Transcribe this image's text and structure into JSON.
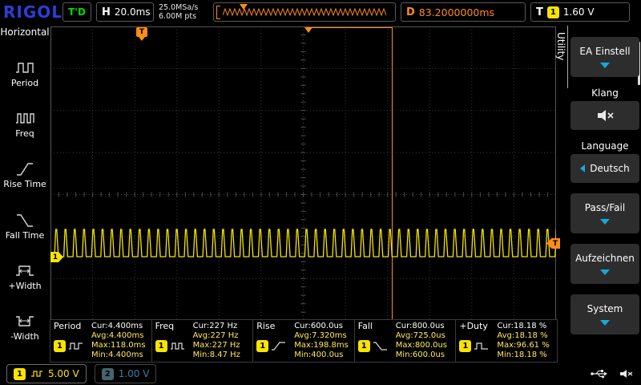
{
  "brand": "RIGOL",
  "topbar": {
    "trig_status": "T'D",
    "h_label": "H",
    "timebase": "20.0ms",
    "sample_rate": "25.0MSa/s",
    "memory_depth": "6.00M pts",
    "d_label": "D",
    "delay": "83.2000000ms",
    "t_label": "T",
    "trig_source": "1",
    "trig_level": "1.60 V"
  },
  "left_menu": {
    "title": "Horizontal",
    "items": [
      {
        "label": "Period"
      },
      {
        "label": "Freq"
      },
      {
        "label": "Rise Time"
      },
      {
        "label": "Fall Time"
      },
      {
        "label": "+Width"
      },
      {
        "label": "-Width"
      }
    ]
  },
  "right_menu": {
    "tab": "Utility",
    "io_setup": "EA Einstell",
    "sound": "Klang",
    "language_label": "Language",
    "language_value": "Deutsch",
    "pass_fail": "Pass/Fail",
    "record": "Aufzeichnen",
    "system": "System"
  },
  "measurements": [
    {
      "name": "Period",
      "source": "1",
      "cur": "Cur:4.400ms",
      "avg": "Avg:4.400ms",
      "max": "Max:118.0ms",
      "min": "Min:4.400ms"
    },
    {
      "name": "Freq",
      "source": "1",
      "cur": "Cur:227 Hz",
      "avg": "Avg:227 Hz",
      "max": "Max:227 Hz",
      "min": "Min:8.47 Hz"
    },
    {
      "name": "Rise",
      "source": "1",
      "cur": "Cur:600.0us",
      "avg": "Avg:7.320ms",
      "max": "Max:198.8ms",
      "min": "Min:400.0us"
    },
    {
      "name": "Fall",
      "source": "1",
      "cur": "Cur:800.0us",
      "avg": "Avg:725.0us",
      "max": "Max:800.0us",
      "min": "Min:600.0us"
    },
    {
      "name": "+Duty",
      "source": "1",
      "cur": "Cur:18.18 %",
      "avg": "Avg:18.18 %",
      "max": "Max:96.61 %",
      "min": "Min:18.18 %"
    }
  ],
  "channels": [
    {
      "num": "1",
      "scale": "5.00 V"
    },
    {
      "num": "2",
      "scale": "1.00 V"
    }
  ],
  "markers": {
    "trigger_flag": "T",
    "trigger_level_label": "T"
  },
  "chart_data": {
    "type": "line",
    "title": "CH1 pulse train",
    "x_unit": "ms",
    "y_unit": "V",
    "timebase_ms_per_div": 20,
    "h_divisions": 12,
    "v_divisions": 8,
    "volts_per_div": 5.0,
    "period_ms": 4.4,
    "frequency_hz": 227,
    "duty_pct": 18.18,
    "rise_ms": 0.6,
    "fall_ms": 0.8,
    "amplitude_divs": 0.65,
    "baseline_frac": 0.685,
    "trigger_level_v": 1.6,
    "trigger_delay_ms": 83.2,
    "pulses_on_screen": 55
  },
  "colors": {
    "ch1": "#f8e400",
    "ch2_dim": "#3d7d9d",
    "trigger": "#ff8c1a",
    "trig_status": "#00d900",
    "logo_blue": "#2a3fd6",
    "menu_arrow": "#18a8d8"
  }
}
